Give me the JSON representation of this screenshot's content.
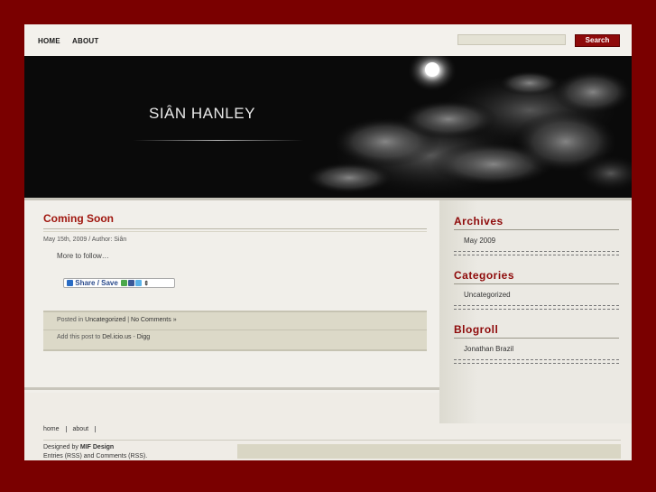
{
  "nav": {
    "items": [
      {
        "label": "HOME"
      },
      {
        "label": "ABOUT"
      }
    ]
  },
  "search": {
    "placeholder": "",
    "button_label": "Search"
  },
  "header": {
    "site_title": "SIÂN HANLEY"
  },
  "post": {
    "title": "Coming Soon",
    "date": "May 15th, 2009",
    "author_prefix": "/ Author:",
    "author": "Siân",
    "body": "More to follow…",
    "share_label": "Share / Save",
    "posted_in_prefix": "Posted in",
    "category": "Uncategorized",
    "divider": "|",
    "comments": "No Comments »",
    "add_post_prefix": "Add this post to",
    "delicious": "Del.icio.us",
    "dash": "-",
    "digg": "Digg"
  },
  "sidebar": {
    "archives": {
      "title": "Archives",
      "items": [
        "May 2009"
      ]
    },
    "categories": {
      "title": "Categories",
      "items": [
        "Uncategorized"
      ]
    },
    "blogroll": {
      "title": "Blogroll",
      "items": [
        "Jonathan Brazil"
      ]
    }
  },
  "footer": {
    "nav": [
      "home",
      "about"
    ],
    "designed_by_prefix": "Designed by",
    "designer": "MIF Design",
    "entries_rss": "Entries (RSS)",
    "and_text": "and",
    "comments_rss": "Comments (RSS)",
    "end_dot": "."
  },
  "colors": {
    "frame": "#7a0000",
    "accent": "#8e0a0a",
    "title_red": "#a0170f"
  }
}
